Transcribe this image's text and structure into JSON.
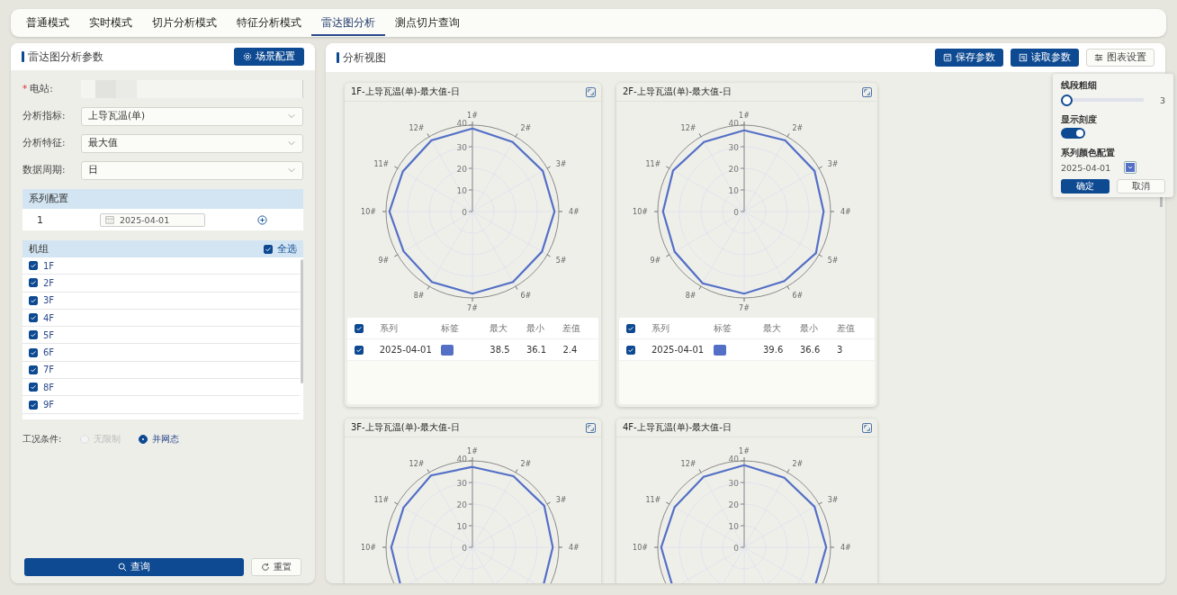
{
  "tabs": [
    {
      "label": "普通模式",
      "selected": false
    },
    {
      "label": "实时模式",
      "selected": false
    },
    {
      "label": "切片分析模式",
      "selected": false
    },
    {
      "label": "特征分析模式",
      "selected": false
    },
    {
      "label": "雷达图分析",
      "selected": true
    },
    {
      "label": "测点切片查询",
      "selected": false
    }
  ],
  "params_panel": {
    "title": "雷达图分析参数",
    "scene_button": "场景配置",
    "fields": [
      {
        "kind": "blank",
        "mark": "*",
        "label": "电站:"
      },
      {
        "kind": "select",
        "label": "分析指标:",
        "value": "上导瓦温(单)"
      },
      {
        "kind": "select",
        "label": "分析特征:",
        "value": "最大值"
      },
      {
        "kind": "select",
        "label": "数据周期:",
        "value": "日"
      }
    ],
    "series_config": {
      "title": "系列配置",
      "rows": [
        {
          "index": "1",
          "date": "2025-04-01"
        }
      ]
    },
    "units": {
      "title": "机组",
      "select_all": {
        "label": "全选",
        "checked": true
      },
      "items": [
        {
          "label": "1F",
          "checked": true
        },
        {
          "label": "2F",
          "checked": true
        },
        {
          "label": "3F",
          "checked": true
        },
        {
          "label": "4F",
          "checked": true
        },
        {
          "label": "5F",
          "checked": true
        },
        {
          "label": "6F",
          "checked": true
        },
        {
          "label": "7F",
          "checked": true
        },
        {
          "label": "8F",
          "checked": true
        },
        {
          "label": "9F",
          "checked": true
        }
      ]
    },
    "condition": {
      "label": "工况条件:",
      "options": [
        {
          "label": "无限制",
          "selected": false,
          "disabled": true
        },
        {
          "label": "并网态",
          "selected": true,
          "disabled": false
        }
      ]
    },
    "query_button": "查询",
    "reset_button": "重置"
  },
  "view_panel": {
    "title": "分析视图",
    "buttons": [
      {
        "kind": "save",
        "label": "保存参数"
      },
      {
        "kind": "load",
        "label": "读取参数"
      },
      {
        "kind": "settings",
        "label": "图表设置"
      }
    ],
    "charts": [
      {
        "title": "1F-上导瓦温(单)-最大值-日",
        "radar": {
          "spoke_labels": [
            "1#",
            "2#",
            "3#",
            "4#",
            "5#",
            "6#",
            "7#",
            "8#",
            "9#",
            "10#",
            "11#",
            "12#"
          ],
          "ring_labels": [
            "40",
            "30",
            "20",
            "10",
            "0"
          ]
        },
        "table": {
          "all_checked": true,
          "columns": [
            "系列",
            "标签",
            "最大",
            "最小",
            "差值"
          ],
          "rows": [
            {
              "checked": true,
              "series": "2025-04-01",
              "color": "#5470c6",
              "max": "38.5",
              "min": "36.1",
              "diff": "2.4"
            }
          ]
        }
      },
      {
        "title": "2F-上导瓦温(单)-最大值-日",
        "radar": {
          "spoke_labels": [
            "1#",
            "2#",
            "3#",
            "4#",
            "5#",
            "6#",
            "7#",
            "8#",
            "9#",
            "10#",
            "11#",
            "12#"
          ],
          "ring_labels": [
            "40",
            "30",
            "20",
            "10",
            "0"
          ]
        },
        "table": {
          "all_checked": true,
          "columns": [
            "系列",
            "标签",
            "最大",
            "最小",
            "差值"
          ],
          "rows": [
            {
              "checked": true,
              "series": "2025-04-01",
              "color": "#5470c6",
              "max": "39.6",
              "min": "36.6",
              "diff": "3"
            }
          ]
        }
      },
      {
        "title": "3F-上导瓦温(单)-最大值-日",
        "radar": {
          "spoke_labels": [
            "1#",
            "2#",
            "3#",
            "4#"
          ],
          "spoke_labels_end": [
            "10#",
            "11#",
            "12#"
          ],
          "ring_labels": [
            "40",
            "30",
            "20",
            "10",
            "0"
          ]
        }
      },
      {
        "title": "4F-上导瓦温(单)-最大值-日",
        "radar": {
          "spoke_labels": [
            "1#",
            "2#",
            "3#",
            "4#"
          ],
          "spoke_labels_end": [
            "10#",
            "11#",
            "12#"
          ],
          "ring_labels": [
            "40",
            "30",
            "20",
            "10",
            "0"
          ]
        }
      }
    ]
  },
  "chart_settings": {
    "line_width": {
      "label": "线段粗细",
      "level": 0,
      "reading": "3"
    },
    "show_scale": {
      "label": "显示刻度",
      "on": true
    },
    "series_colors": {
      "label": "系列颜色配置",
      "items": [
        {
          "date": "2025-04-01",
          "color": "#5470c6"
        }
      ]
    },
    "confirm": "确定",
    "cancel": "取消"
  }
}
